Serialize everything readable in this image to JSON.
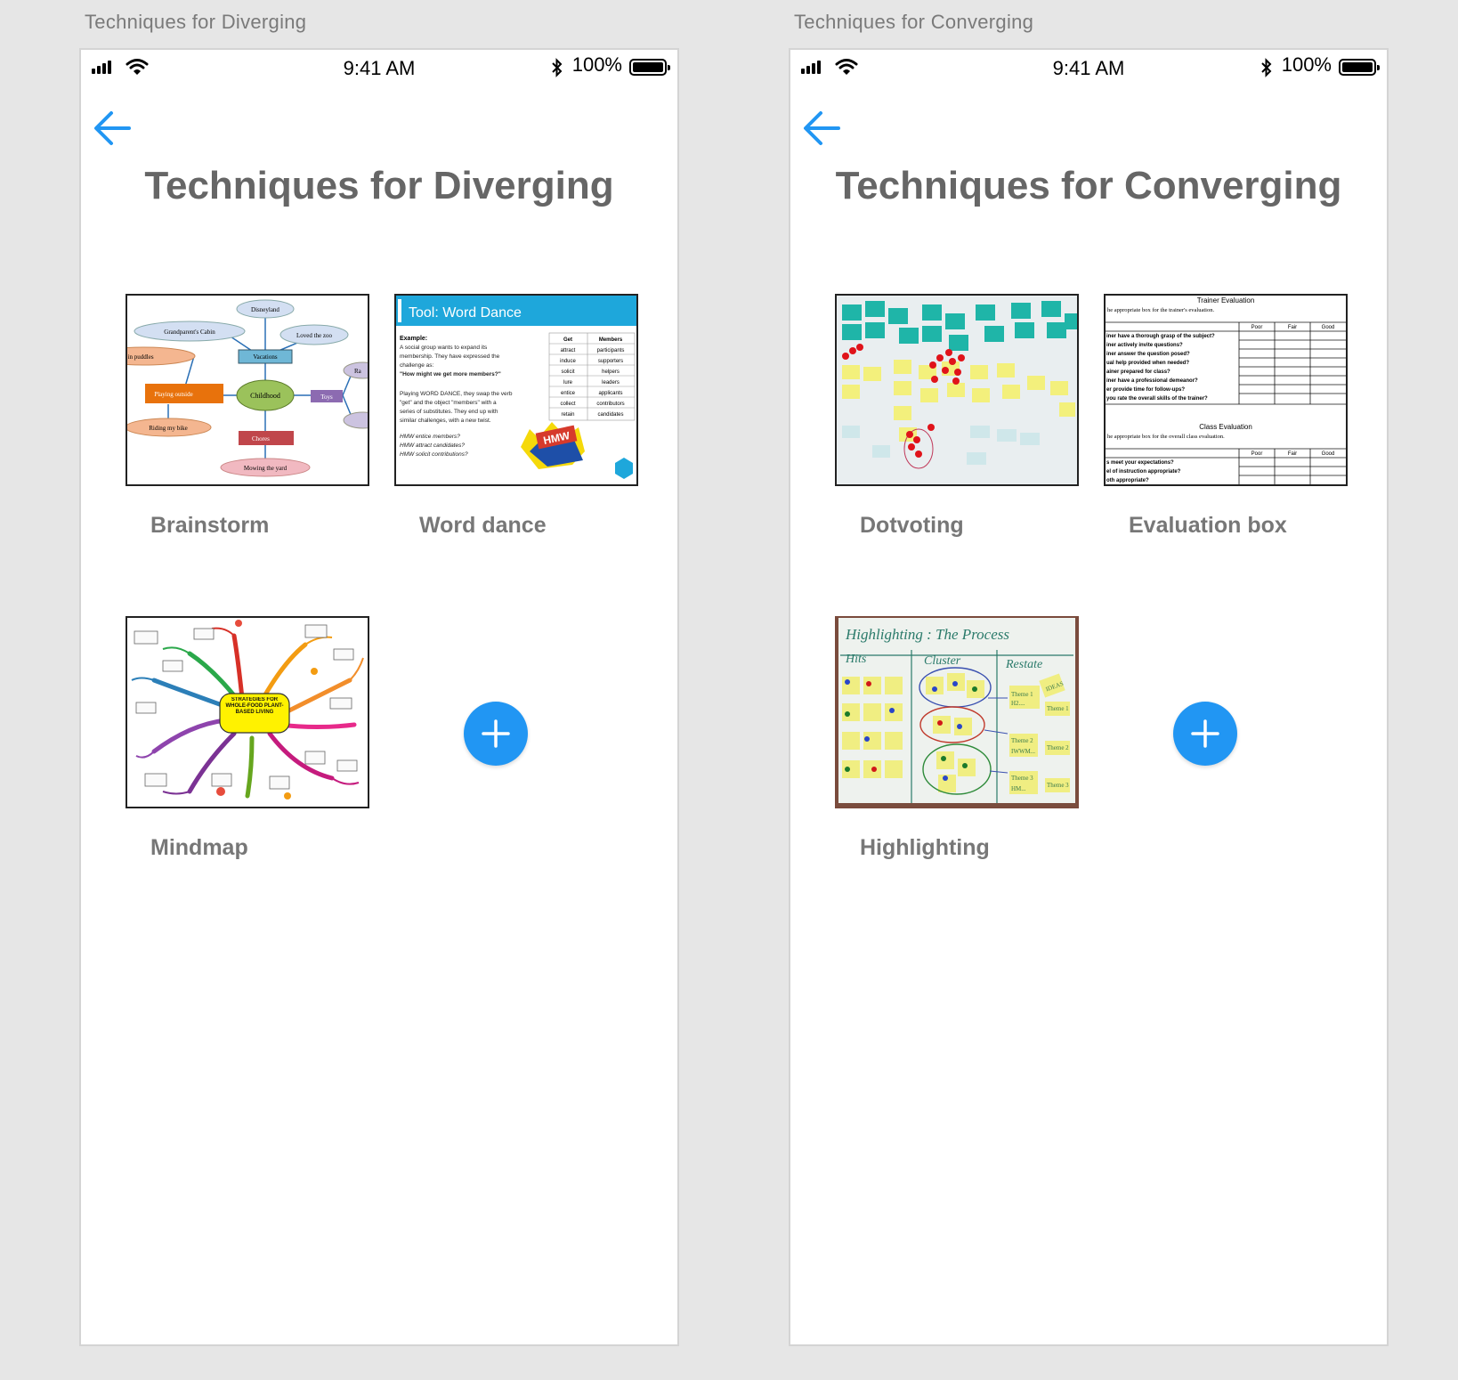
{
  "theme": {
    "accent": "#2196f3",
    "title_color": "#666666"
  },
  "screens": [
    {
      "artboard_label": "Techniques for Diverging",
      "status": {
        "time": "9:41 AM",
        "battery": "100%"
      },
      "back_icon": "arrow-left-icon",
      "title": "Techniques for Diverging",
      "cards": [
        {
          "label": "Brainstorm",
          "thumb": {
            "center": "Childhood",
            "nodes": [
              "Disneyland",
              "Grandparent's Cabin",
              "Loved the zoo",
              "Vacations",
              "Playing outside",
              "Toys",
              "Chores",
              "Riding my bike",
              "Mowing the yard",
              "ping in puddles",
              "Ra"
            ]
          }
        },
        {
          "label": "Word dance",
          "thumb": {
            "heading": "Tool: Word Dance",
            "example": "Example:",
            "lines": [
              "A social group wants to expand its",
              "membership. They have expressed the",
              "challenge as:",
              "\"How might we get more members?\"",
              "Playing WORD DANCE, they swap the verb",
              "\"get\" and the object \"members\" with a",
              "series of substitutes. They end up with",
              "similar challenges, with a new twist.",
              "HMW entice members?",
              "HMW attract candidates?",
              "HMW solicit contributions?"
            ],
            "col1_header": "Get",
            "col2_header": "Members",
            "col1": [
              "attract",
              "induce",
              "solicit",
              "lure",
              "entice",
              "collect",
              "retain"
            ],
            "col2": [
              "participants",
              "supporters",
              "helpers",
              "leaders",
              "applicants",
              "contributors",
              "candidates"
            ],
            "badge": "HMW"
          }
        },
        {
          "label": "Mindmap",
          "thumb": {
            "center": "STRATEGIES FOR WHOLE-FOOD PLANT-BASED LIVING"
          }
        }
      ],
      "add_icon": "plus-icon"
    },
    {
      "artboard_label": "Techniques for Converging",
      "status": {
        "time": "9:41 AM",
        "battery": "100%"
      },
      "back_icon": "arrow-left-icon",
      "title": "Techniques for Converging",
      "cards": [
        {
          "label": "Dotvoting"
        },
        {
          "label": "Evaluation box",
          "thumb": {
            "heading1": "Trainer Evaluation",
            "sub1": "he appropriate box for the trainer's evaluation.",
            "cols": [
              "Poor",
              "Fair",
              "Good"
            ],
            "rows1": [
              "iner have a thorough grasp of the subject?",
              "iner actively invite questions?",
              "iner answer the question posed?",
              "ual help provided when needed?",
              "ainer prepared for class?",
              "iner have a professional demeanor?",
              "er provide time for follow-ups?",
              "you rate the overall skills of the trainer?"
            ],
            "heading2": "Class Evaluation",
            "sub2": "he appropriate box for the overall class evaluation.",
            "rows2": [
              "s meet your expectations?",
              "el of instruction appropriate?",
              "oth appropriate?"
            ]
          }
        },
        {
          "label": "Highlighting",
          "thumb": {
            "heading": "Highlighting : The Process",
            "col1": "Hits",
            "col2": "Cluster",
            "col3": "Restate",
            "notes": [
              "Theme 1",
              "H2....",
              "IDEAS",
              "Theme 1",
              "Theme 2",
              "IWWM...",
              "Theme 2",
              "Theme 3",
              "HM...",
              "Theme 3"
            ]
          }
        }
      ],
      "add_icon": "plus-icon"
    }
  ]
}
